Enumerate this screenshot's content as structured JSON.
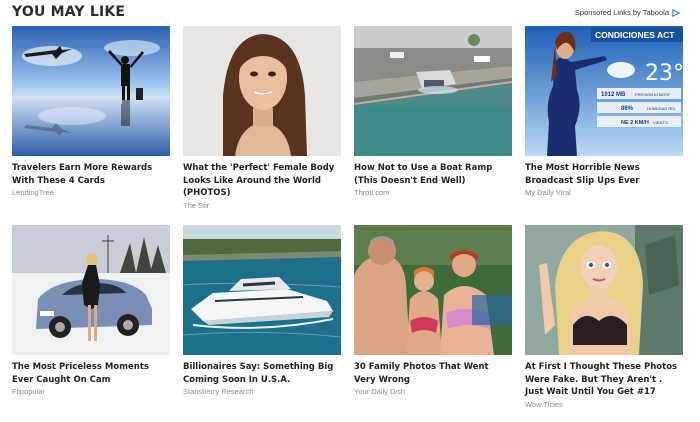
{
  "header": {
    "title": "YOU MAY LIKE",
    "sponsored_label": "Sponsored Links by Taboola"
  },
  "cards": [
    {
      "headline": "Travelers Earn More Rewards With These 4 Cards",
      "branding": "LendingTree"
    },
    {
      "headline": "What the 'Perfect' Female Body Looks Like Around the World (PHOTOS)",
      "branding": "The Stir"
    },
    {
      "headline": "How Not to Use a Boat Ramp (This Doesn't End Well)",
      "branding": "Throti.com"
    },
    {
      "headline": "The Most Horrible News Broadcast Slip Ups Ever",
      "branding": "My Daily Viral"
    },
    {
      "headline": "The Most Priceless Moments Ever Caught On Cam",
      "branding": "Flipopular"
    },
    {
      "headline": "Billionaires Say: Something Big Coming Soon In U.S.A.",
      "branding": "Stansberry Research"
    },
    {
      "headline": "30 Family Photos That Went Very Wrong",
      "branding": "Your Daily Dish"
    },
    {
      "headline": "At First I Thought These Photos Were Fake. But They Aren't . Just Wait Until You Get #17",
      "branding": "Wow Ticles"
    }
  ],
  "weather": {
    "title": "CONDICIONES ACT",
    "temp": "23°",
    "pressure": "1012 MB",
    "pressure_label": "PRESION ATMOSF",
    "humidity": "86%",
    "humidity_label": "HUMEDAD REL",
    "wind": "NE 2 KM/H",
    "wind_label": "VIENTO"
  },
  "colors": {
    "brand_taboola": "#1f8ded",
    "headline": "#222222",
    "branding": "#888888"
  }
}
